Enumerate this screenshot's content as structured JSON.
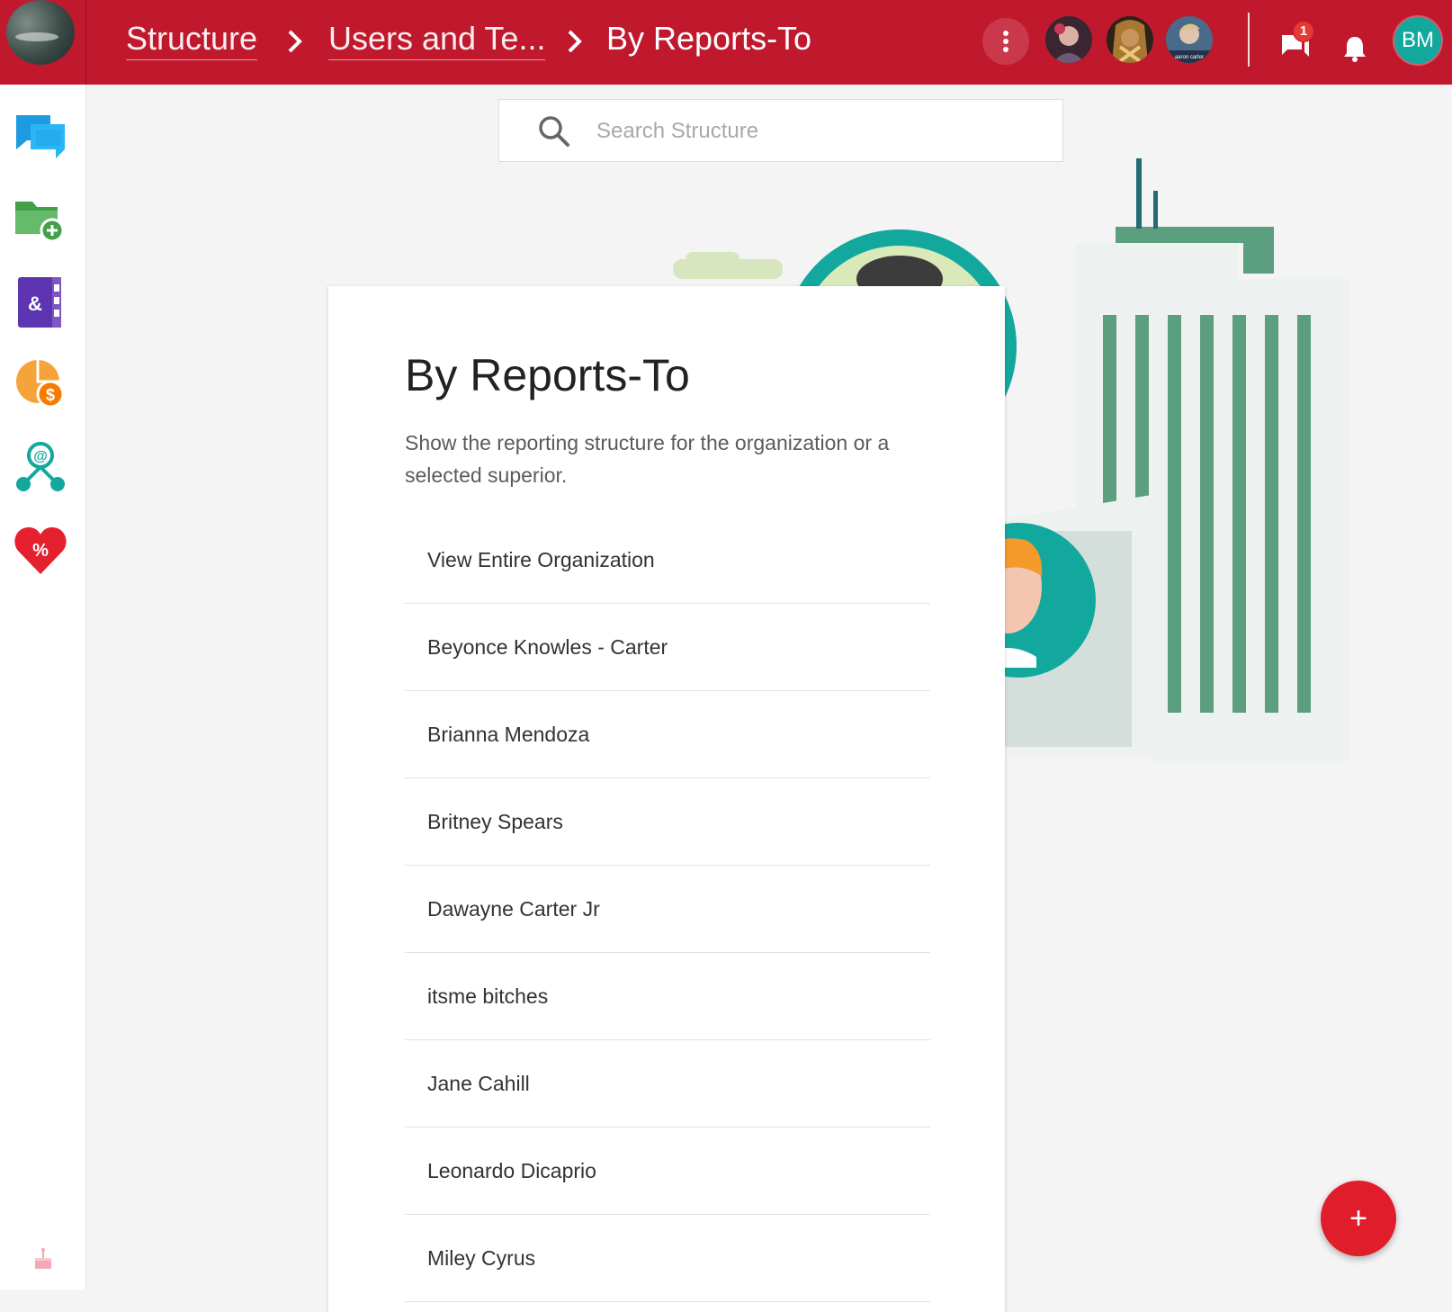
{
  "breadcrumb": {
    "items": [
      "Structure",
      "Users and Te..."
    ],
    "current": "By Reports-To"
  },
  "header": {
    "user_initials": "BM",
    "chat_badge_count": "1",
    "avatar_3_caption": "aaron carter"
  },
  "search": {
    "placeholder": "Search Structure"
  },
  "card": {
    "title": "By Reports-To",
    "description": "Show the reporting structure for the organization or a selected superior.",
    "items": [
      "View Entire Organization",
      "Beyonce Knowles - Carter",
      "Brianna Mendoza",
      "Britney Spears",
      "Dawayne Carter Jr",
      "itsme bitches",
      "Jane Cahill",
      "Leonardo Dicaprio",
      "Miley Cyrus"
    ]
  },
  "sidebar": {
    "icons": [
      "chat-icon",
      "folder-add-icon",
      "contacts-book-icon",
      "pie-chart-dollar-icon",
      "org-structure-icon",
      "heart-percent-icon"
    ],
    "bottom_icon": "birthday-cake-icon"
  },
  "fab": {
    "label": "+"
  },
  "colors": {
    "header": "#c0192e",
    "accent_teal": "#13a89e",
    "fab": "#e01e2b",
    "badge": "#e53935"
  }
}
